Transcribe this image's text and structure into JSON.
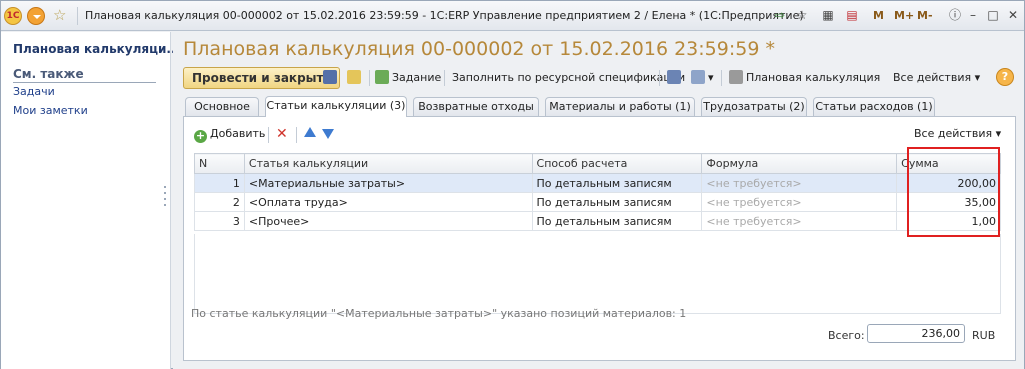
{
  "titlebar": {
    "logo": "1С",
    "text": "Плановая калькуляция 00-000002 от 15.02.2016 23:59:59 - 1С:ERP Управление предприятием 2 / Елена * (1С:Предприятие)",
    "mem": [
      "M",
      "M+",
      "M-"
    ]
  },
  "left_panel": {
    "title": "Плановая калькуляци...",
    "see_also": "См. также",
    "links": [
      "Задачи",
      "Мои заметки"
    ]
  },
  "document": {
    "title": "Плановая калькуляция 00-000002 от 15.02.2016 23:59:59 *"
  },
  "toolbar": {
    "post_close": "Провести и закрыть",
    "task": "Задание",
    "fill": "Заполнить по ресурсной спецификации",
    "print": "Плановая калькуляция",
    "all_actions": "Все действия ▾",
    "help": "?"
  },
  "tabs": [
    "Основное",
    "Статьи калькуляции (3)",
    "Возвратные отходы",
    "Материалы и работы (1)",
    "Трудозатраты (2)",
    "Статьи расходов (1)"
  ],
  "sub_toolbar": {
    "add": "Добавить",
    "all_actions": "Все действия ▾"
  },
  "table": {
    "headers": [
      "N",
      "Статья калькуляции",
      "Способ расчета",
      "Формула",
      "Сумма"
    ],
    "rows": [
      [
        "1",
        "<Материальные затраты>",
        "По детальным записям",
        "<не требуется>",
        "200,00"
      ],
      [
        "2",
        "<Оплата труда>",
        "По детальным записям",
        "<не требуется>",
        "35,00"
      ],
      [
        "3",
        "<Прочее>",
        "По детальным записям",
        "<не требуется>",
        "1,00"
      ]
    ]
  },
  "footer": {
    "info": "По статье калькуляции \"<Материальные затраты>\" указано позиций материалов: 1",
    "total_label": "Всего:",
    "total_value": "236,00",
    "currency": "RUB"
  }
}
